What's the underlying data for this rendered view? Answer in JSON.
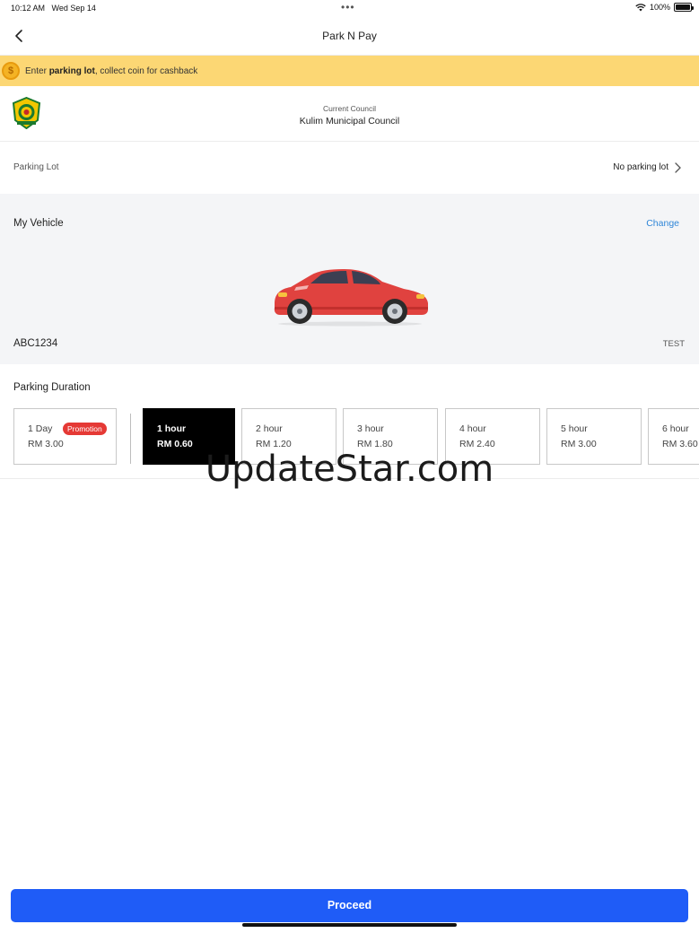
{
  "status_bar": {
    "time": "10:12 AM",
    "date": "Wed Sep 14",
    "dots": "•••",
    "battery": "100%"
  },
  "nav": {
    "title": "Park N Pay",
    "back_icon": "chevron-left-icon"
  },
  "banner": {
    "icon": "coin-icon",
    "text_before": "Enter ",
    "text_bold": "parking lot",
    "text_after": ", collect coin for cashback"
  },
  "council": {
    "caption": "Current Council",
    "name": "Kulim Municipal Council"
  },
  "parking_lot": {
    "label": "Parking Lot",
    "value": "No parking lot"
  },
  "vehicle": {
    "title": "My Vehicle",
    "change_label": "Change",
    "plate": "ABC1234",
    "name": "TEST",
    "car_color": "#e0423f"
  },
  "duration": {
    "title": "Parking Duration",
    "options": [
      {
        "label": "1 Day",
        "price": "RM 3.00",
        "badge": "Promotion"
      },
      {
        "label": "1 hour",
        "price": "RM 0.60",
        "selected": true
      },
      {
        "label": "2 hour",
        "price": "RM 1.20"
      },
      {
        "label": "3 hour",
        "price": "RM 1.80"
      },
      {
        "label": "4 hour",
        "price": "RM 2.40"
      },
      {
        "label": "5 hour",
        "price": "RM 3.00"
      },
      {
        "label": "6 hour",
        "price": "RM 3.60"
      }
    ]
  },
  "watermark": "UpdateStar.com",
  "footer": {
    "proceed_label": "Proceed"
  },
  "colors": {
    "banner": "#fcd774",
    "accent_link": "#2f86d8",
    "primary_button": "#1f5cf7",
    "promo_badge": "#e53935",
    "selected_card": "#000000"
  }
}
